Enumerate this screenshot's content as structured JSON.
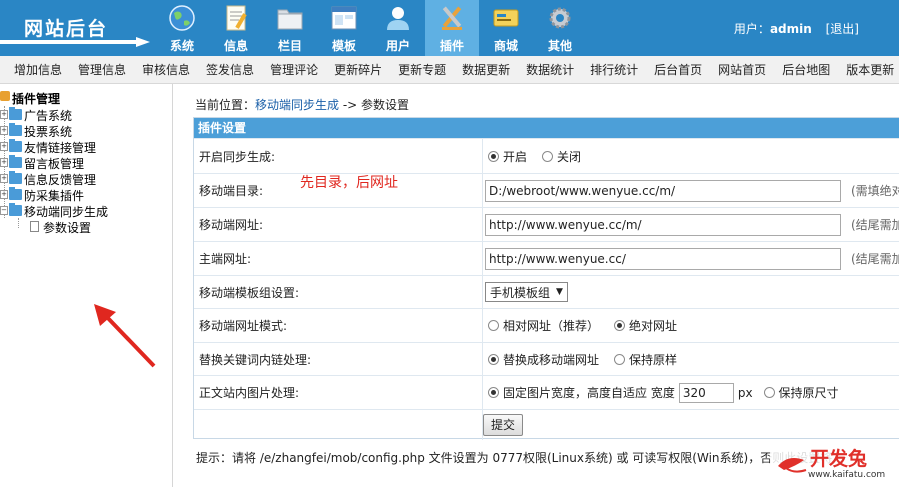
{
  "header": {
    "logo": "网站后台",
    "nav": [
      {
        "label": "系统",
        "icon": "globe-icon"
      },
      {
        "label": "信息",
        "icon": "document-edit-icon"
      },
      {
        "label": "栏目",
        "icon": "folder-icon"
      },
      {
        "label": "模板",
        "icon": "window-template-icon"
      },
      {
        "label": "用户",
        "icon": "user-icon"
      },
      {
        "label": "插件",
        "icon": "plugin-tools-icon",
        "active": true
      },
      {
        "label": "商城",
        "icon": "card-icon"
      },
      {
        "label": "其他",
        "icon": "gear-icon"
      }
    ],
    "user_prefix": "用户：",
    "username": "admin",
    "logout": "[退出]"
  },
  "submenu": [
    "增加信息",
    "管理信息",
    "审核信息",
    "签发信息",
    "管理评论",
    "更新碎片",
    "更新专题",
    "数据更新",
    "数据统计",
    "排行统计",
    "后台首页",
    "网站首页",
    "后台地图",
    "版本更新"
  ],
  "tree": {
    "root": "插件管理",
    "nodes": [
      "广告系统",
      "投票系统",
      "友情链接管理",
      "留言板管理",
      "信息反馈管理",
      "防采集插件",
      "移动端同步生成"
    ],
    "leaf": "参数设置"
  },
  "breadcrumb": {
    "prefix": "当前位置：",
    "link": "移动端同步生成",
    "sep": " -> ",
    "current": "参数设置"
  },
  "panel": {
    "title": "插件设置",
    "rows": {
      "sync": {
        "label": "开启同步生成:",
        "opt1": "开启",
        "opt2": "关闭"
      },
      "mobile_dir": {
        "label": "移动端目录:",
        "value": "D:/webroot/www.wenyue.cc/m/",
        "hint": "(需填绝对"
      },
      "mobile_url": {
        "label": "移动端网址:",
        "value": "http://www.wenyue.cc/m/",
        "hint": "(结尾需加"
      },
      "main_url": {
        "label": "主端网址:",
        "value": "http://www.wenyue.cc/",
        "hint": "(结尾需加"
      },
      "template": {
        "label": "移动端模板组设置:",
        "value": "手机模板组"
      },
      "url_mode": {
        "label": "移动端网址模式:",
        "opt1": "相对网址（推荐）",
        "opt2": "绝对网址"
      },
      "keyword": {
        "label": "替换关键词内链处理:",
        "opt1": "替换成移动端网址",
        "opt2": "保持原样"
      },
      "image": {
        "label": "正文站内图片处理:",
        "opt1": "固定图片宽度，高度自适应 宽度",
        "width": "320",
        "unit": "px",
        "opt2": "保持原尺寸"
      }
    },
    "submit": "提交"
  },
  "annotation": "先目录，后网址",
  "tip": "提示：请将 /e/zhangfei/mob/config.php 文件设置为 0777权限(Linux系统) 或 可读写权限(Win系统)，否则此设置将",
  "watermark": {
    "text": "开发兔",
    "sub": "www.kaifatu.com"
  }
}
